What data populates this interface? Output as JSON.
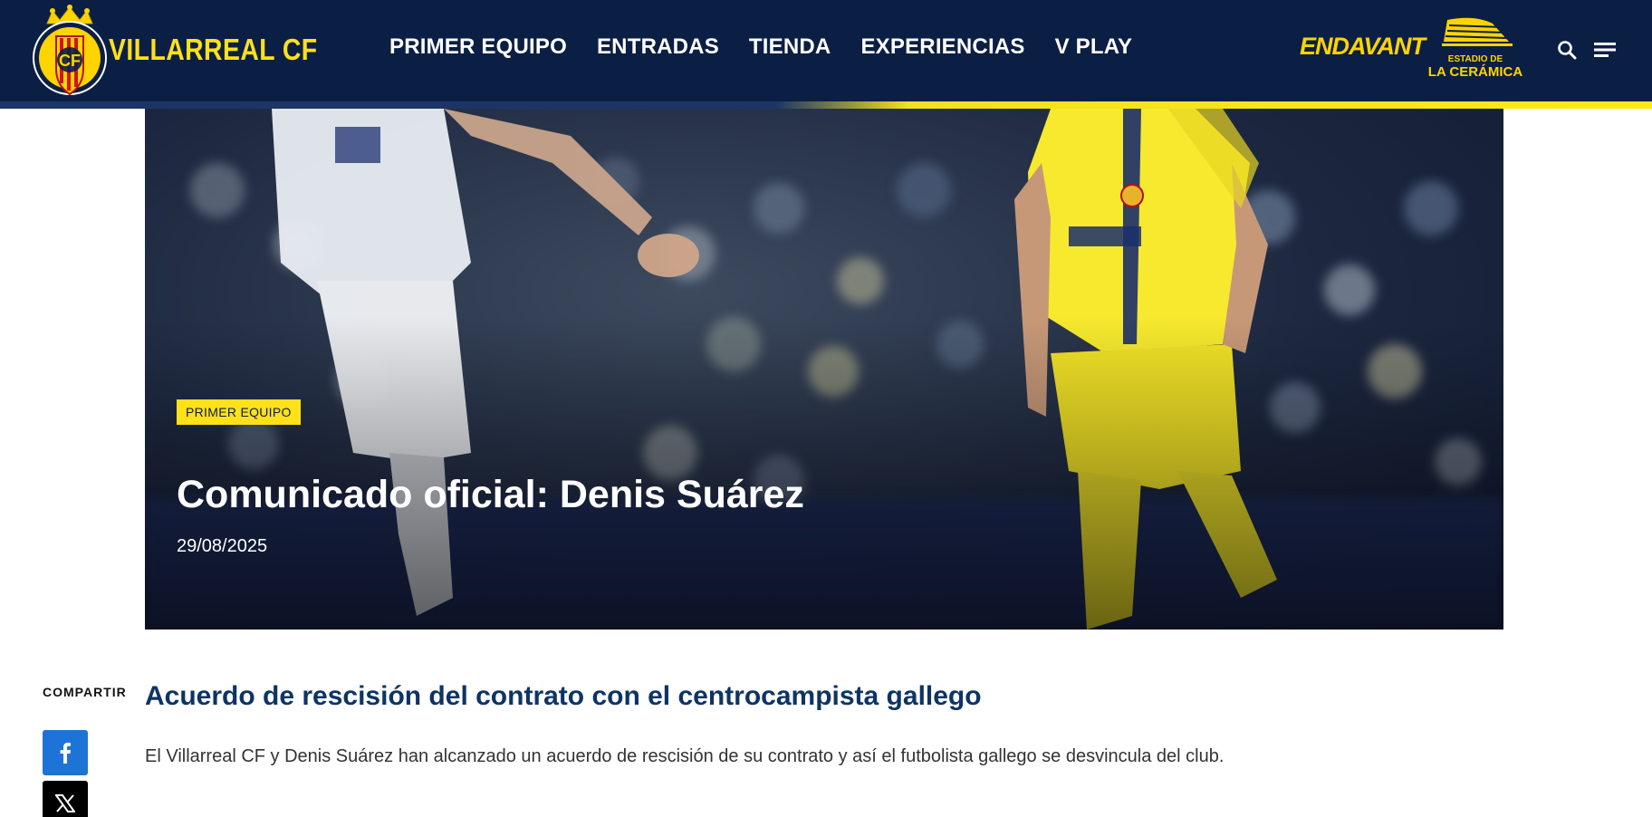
{
  "header": {
    "brand": "VILLARREAL CF",
    "logo_letters": "CF",
    "nav": [
      "PRIMER EQUIPO",
      "ENTRADAS",
      "TIENDA",
      "EXPERIENCIAS",
      "V PLAY"
    ],
    "sponsor": "ENDAVANT",
    "stadium_line1": "ESTADIO DE",
    "stadium_line2": "LA CERÁMICA",
    "search_icon": "search-icon",
    "menu_icon": "hamburger-menu-icon"
  },
  "hero": {
    "category": "PRIMER EQUIPO",
    "title": "Comunicado oficial: Denis Suárez",
    "date": "29/08/2025"
  },
  "article": {
    "share_label": "COMPARTIR",
    "share_buttons": [
      "facebook-icon",
      "x-icon"
    ],
    "subtitle": "Acuerdo de rescisión del contrato con el centrocampista gallego",
    "body": "El Villarreal CF y Denis Suárez han alcanzado un acuerdo de rescisión de su contrato y así el futbolista gallego se desvincula del club."
  },
  "colors": {
    "navy": "#0b1f45",
    "yellow": "#ffe11a",
    "title_blue": "#0e3465",
    "facebook": "#1e74d6"
  }
}
